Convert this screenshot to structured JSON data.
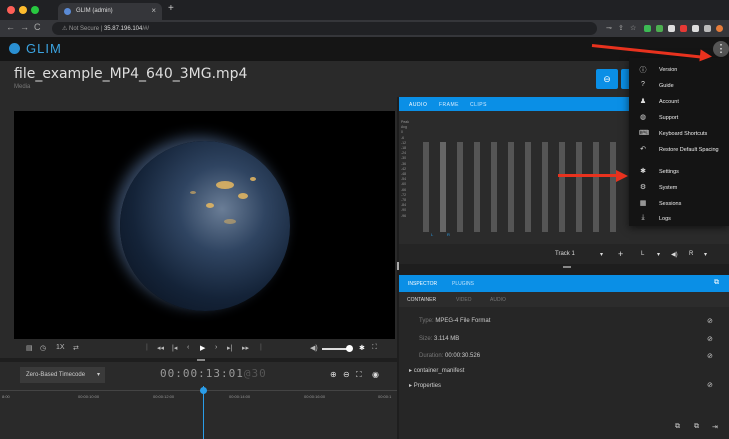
{
  "browser": {
    "tab_title": "GLIM (admin)",
    "tab_close": "×",
    "new_tab": "+",
    "url_prefix": "Not Secure",
    "url_host": "35.87.196.104",
    "url_rest": "/#/"
  },
  "app": {
    "name": "GLIM",
    "menu_icon": "⋮"
  },
  "file": {
    "title": "file_example_MP4_640_3MG.mp4",
    "subtitle": "Media"
  },
  "player": {
    "speed": "1X"
  },
  "timeline": {
    "mode": "Zero-Based Timecode",
    "timecode": "00:00:13:01",
    "frame_rate": "@30",
    "ruler_labels": [
      "00:00:10:00",
      "00:00:12:00",
      "00:00:14:00",
      "00:00:16:00",
      "00:00:1"
    ]
  },
  "meter": {
    "tabs": [
      "AUDIO",
      "FRAME",
      "CLIPS"
    ],
    "scale": [
      "Peak",
      "Avg",
      "0",
      "-6",
      "-12",
      "-18",
      "-24",
      "-30",
      "-36",
      "-42",
      "-48",
      "-54",
      "-60",
      "-66",
      "-72",
      "-78",
      "-84",
      "-90",
      "-96"
    ],
    "channel_labels": [
      "L",
      "R"
    ],
    "track": "Track 1",
    "channel_l": "L",
    "channel_r": "R"
  },
  "inspector": {
    "tabs": [
      "INSPECTOR",
      "PLUGINS"
    ],
    "subtabs": [
      "CONTAINER",
      "VIDEO",
      "AUDIO"
    ],
    "type_label": "Type:",
    "type_value": "MPEG-4 File Format",
    "size_label": "Size:",
    "size_value": "3.114 MB",
    "duration_label": "Duration:",
    "duration_value": "00:00:30.526",
    "tree": [
      "container_manifest",
      "Properties"
    ]
  },
  "menu": {
    "items": [
      {
        "label": "Version",
        "icon": "info-icon"
      },
      {
        "label": "Guide",
        "icon": "help-icon"
      },
      {
        "label": "Account",
        "icon": "person-icon"
      },
      {
        "label": "Support",
        "icon": "support-icon"
      },
      {
        "label": "Keyboard Shortcuts",
        "icon": "keyboard-icon"
      },
      {
        "label": "Restore Default Spacing",
        "icon": "undo-icon"
      },
      {
        "label": "Settings",
        "icon": "gear-icon"
      },
      {
        "label": "System",
        "icon": "system-icon"
      },
      {
        "label": "Sessions",
        "icon": "sessions-icon"
      },
      {
        "label": "Logs",
        "icon": "download-icon"
      }
    ]
  },
  "colors": {
    "accent": "#0a8fe6",
    "arrow": "#e8321e",
    "logo": "#3ba3e0"
  }
}
